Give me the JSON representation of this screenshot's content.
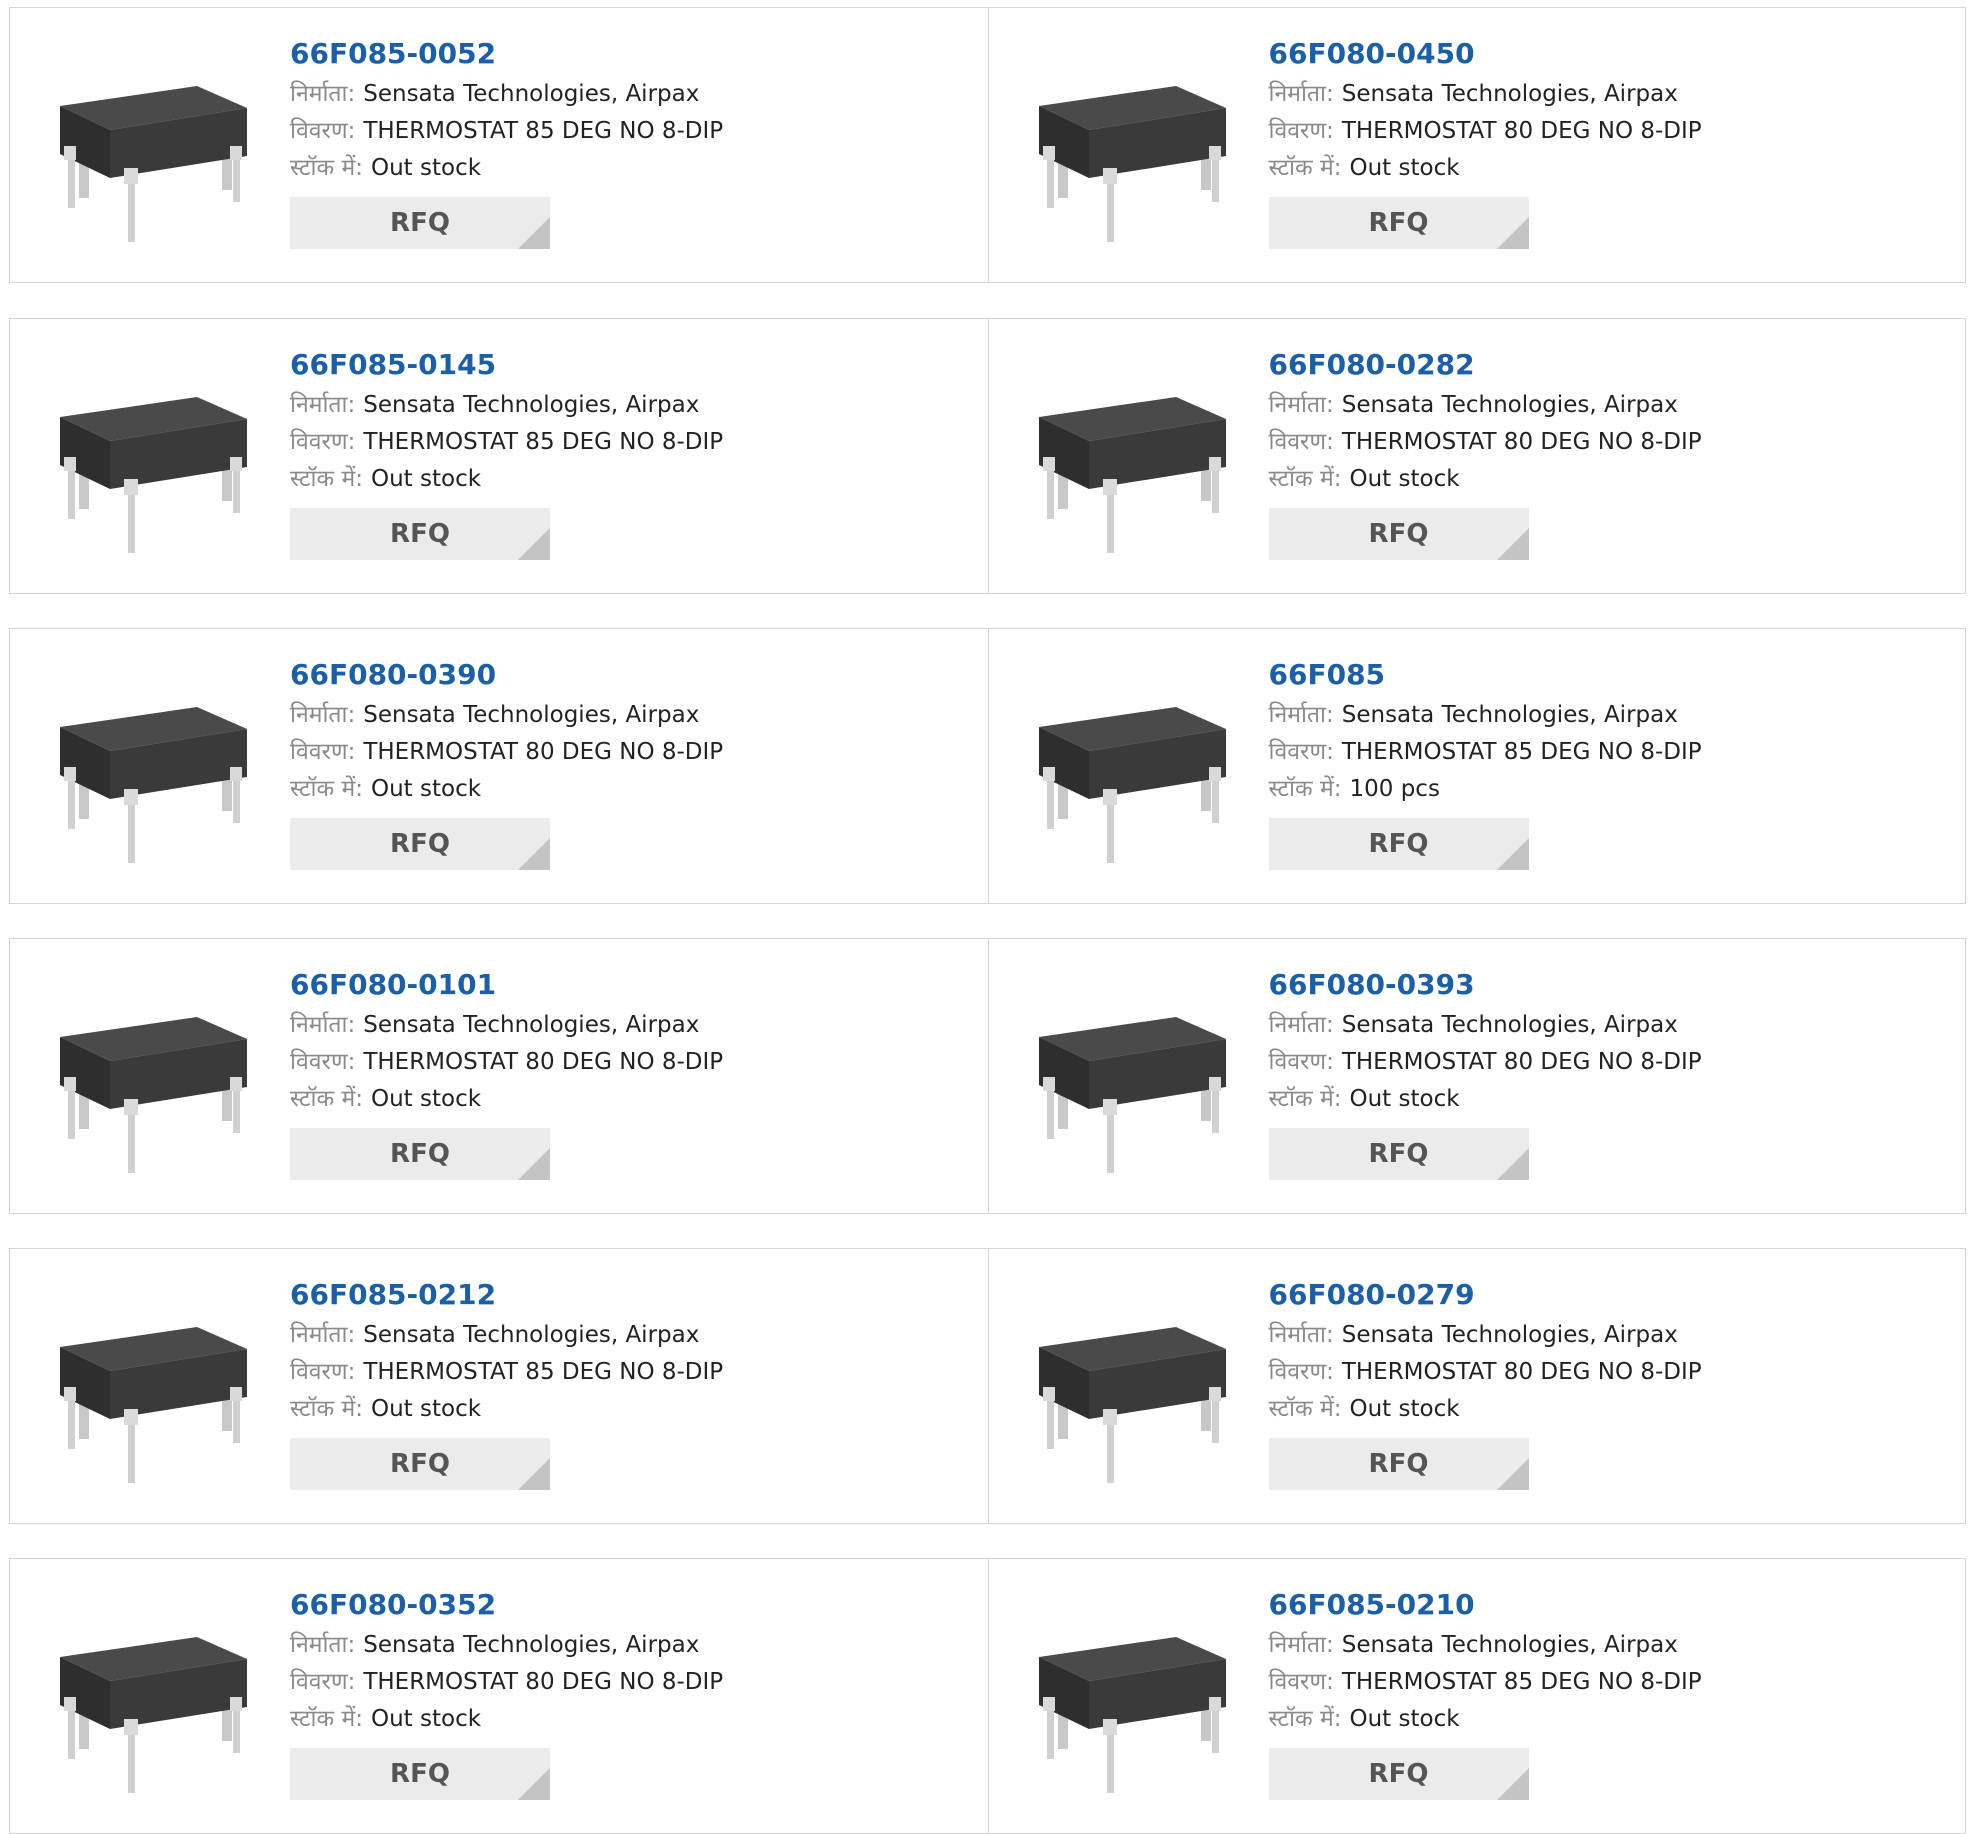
{
  "labels": {
    "manufacturer": "निर्माता:",
    "description": "विवरण:",
    "stock": "स्टॉक में:",
    "rfq": "RFQ"
  },
  "colors": {
    "part_link": "#1a5fa8",
    "border": "#d5d5d5",
    "button_bg": "#ebebeb",
    "button_corner": "#c4c4c4",
    "chip_body": "#3a3a3a",
    "chip_leads": "#d9d9d9"
  },
  "product_image_icon": "dip-8-chip-icon",
  "products": [
    {
      "part": "66F085-0052",
      "manufacturer": "Sensata Technologies, Airpax",
      "description": "THERMOSTAT 85 DEG NO 8-DIP",
      "stock": "Out stock"
    },
    {
      "part": "66F080-0450",
      "manufacturer": "Sensata Technologies, Airpax",
      "description": "THERMOSTAT 80 DEG NO 8-DIP",
      "stock": "Out stock"
    },
    {
      "part": "66F085-0145",
      "manufacturer": "Sensata Technologies, Airpax",
      "description": "THERMOSTAT 85 DEG NO 8-DIP",
      "stock": "Out stock"
    },
    {
      "part": "66F080-0282",
      "manufacturer": "Sensata Technologies, Airpax",
      "description": "THERMOSTAT 80 DEG NO 8-DIP",
      "stock": "Out stock"
    },
    {
      "part": "66F080-0390",
      "manufacturer": "Sensata Technologies, Airpax",
      "description": "THERMOSTAT 80 DEG NO 8-DIP",
      "stock": "Out stock"
    },
    {
      "part": "66F085",
      "manufacturer": "Sensata Technologies, Airpax",
      "description": "THERMOSTAT 85 DEG NO 8-DIP",
      "stock": "100 pcs"
    },
    {
      "part": "66F080-0101",
      "manufacturer": "Sensata Technologies, Airpax",
      "description": "THERMOSTAT 80 DEG NO 8-DIP",
      "stock": "Out stock"
    },
    {
      "part": "66F080-0393",
      "manufacturer": "Sensata Technologies, Airpax",
      "description": "THERMOSTAT 80 DEG NO 8-DIP",
      "stock": "Out stock"
    },
    {
      "part": "66F085-0212",
      "manufacturer": "Sensata Technologies, Airpax",
      "description": "THERMOSTAT 85 DEG NO 8-DIP",
      "stock": "Out stock"
    },
    {
      "part": "66F080-0279",
      "manufacturer": "Sensata Technologies, Airpax",
      "description": "THERMOSTAT 80 DEG NO 8-DIP",
      "stock": "Out stock"
    },
    {
      "part": "66F080-0352",
      "manufacturer": "Sensata Technologies, Airpax",
      "description": "THERMOSTAT 80 DEG NO 8-DIP",
      "stock": "Out stock"
    },
    {
      "part": "66F085-0210",
      "manufacturer": "Sensata Technologies, Airpax",
      "description": "THERMOSTAT 85 DEG NO 8-DIP",
      "stock": "Out stock"
    }
  ]
}
